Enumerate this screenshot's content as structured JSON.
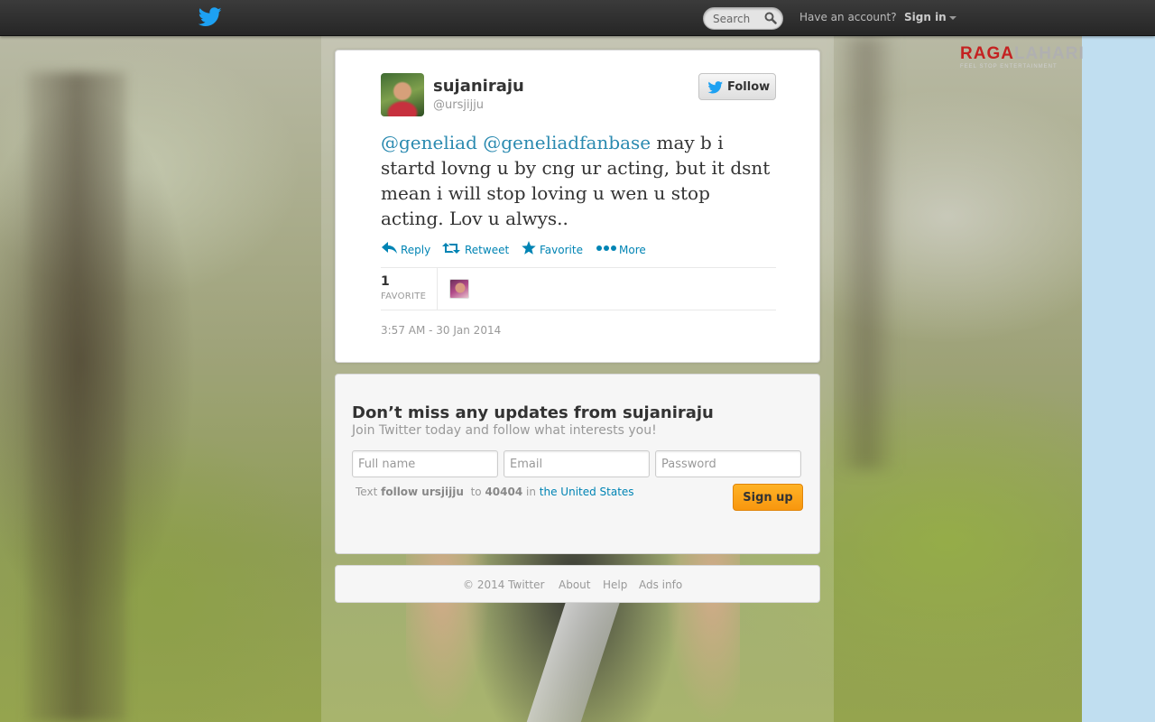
{
  "topbar": {
    "search_placeholder": "Search",
    "have_account": "Have an account?",
    "sign_in": "Sign in"
  },
  "watermark": {
    "brand_red": "RAGA",
    "brand_grey": "LAHARI",
    "tagline": "FEEL STOP ENTERTAINMENT"
  },
  "tweet": {
    "full_name": "sujaniraju",
    "screen_name": "@ursjijju",
    "follow_label": "Follow",
    "mention_1": "@geneliad",
    "mention_2": "@geneliadfanbase",
    "text": "may b i startd lovng u by cng ur acting, but it dsnt mean i will stop loving u wen u stop acting. Lov u alwys..",
    "actions": {
      "reply": "Reply",
      "retweet": "Retweet",
      "favorite": "Favorite",
      "more": "More"
    },
    "stats": {
      "favorites_count": "1",
      "favorites_label": "FAVORITE"
    },
    "timestamp": "3:57 AM - 30 Jan 2014"
  },
  "signup": {
    "title": "Don’t miss any updates from sujaniraju",
    "subtitle": "Join Twitter today and follow what interests you!",
    "full_name_placeholder": "Full name",
    "email_placeholder": "Email",
    "password_placeholder": "Password",
    "sms_text": "Text",
    "sms_command": "follow ursjijju",
    "sms_to": "to",
    "sms_number": "40404",
    "sms_in": "in",
    "sms_country": "the United States",
    "button": "Sign up"
  },
  "footer": {
    "copyright": "© 2014 Twitter",
    "about": "About",
    "help": "Help",
    "ads_info": "Ads info"
  },
  "colors": {
    "link": "#0084b4",
    "mention": "#2a8ab0",
    "twitter_blue": "#1da1f2",
    "signup_orange": "#f8970e",
    "side_bg": "#c0def0"
  },
  "icons": {
    "logo": "twitter-bird-icon",
    "search": "magnifier-icon",
    "reply": "reply-arrow-icon",
    "retweet": "retweet-icon",
    "favorite": "star-icon",
    "more": "dots-icon"
  }
}
